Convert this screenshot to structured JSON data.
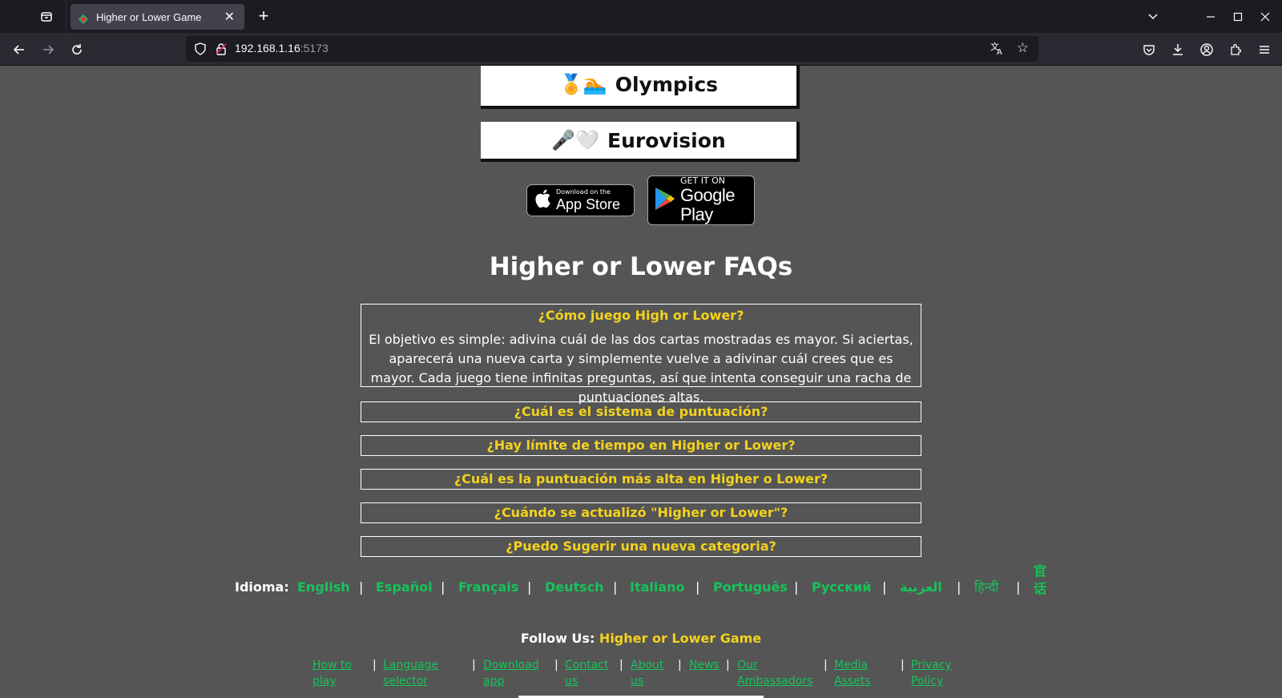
{
  "browser": {
    "tab_title": "Higher or Lower Game",
    "url_host": "192.168.1.16",
    "url_port": ":5173"
  },
  "categories": [
    {
      "emoji": "🏅🏊",
      "label": "Olympics"
    },
    {
      "emoji": "🎤🤍",
      "label": "Eurovision"
    }
  ],
  "store": {
    "appstore_small": "Download on the",
    "appstore_big": "App Store",
    "gplay_small": "GET IT ON",
    "gplay_big": "Google Play"
  },
  "faq": {
    "title": "Higher or Lower FAQs",
    "items": [
      {
        "q": "¿Cómo juego High or Lower?",
        "a": "El objetivo es simple: adivina cuál de las dos cartas mostradas es mayor. Si aciertas, aparecerá una nueva carta y simplemente vuelve a adivinar cuál crees que es mayor. Cada juego tiene infinitas preguntas, así que intenta conseguir una racha de puntuaciones altas."
      },
      {
        "q": "¿Cuál es el sistema de puntuación?"
      },
      {
        "q": "¿Hay límite de tiempo en Higher or Lower?"
      },
      {
        "q": "¿Cuál es la puntuación más alta en Higher o Lower?"
      },
      {
        "q": "¿Cuándo se actualizó \"Higher or Lower\"?"
      },
      {
        "q": "¿Puedo Sugerir una nueva categoria?"
      }
    ]
  },
  "languages": {
    "label": "Idioma:",
    "items": [
      "English",
      "Español",
      "Français",
      "Deutsch",
      "Italiano",
      "Português",
      "Русский",
      "العربية",
      "हिन्दी",
      "官话"
    ],
    "separator": "|"
  },
  "follow": {
    "label": "Follow Us:",
    "link": "Higher or Lower Game"
  },
  "footer": {
    "links": [
      "How to play",
      "Language selector",
      "Download app",
      "Contact us",
      "About us",
      "News",
      "Our Ambassadors",
      "Media Assets",
      "Privacy Policy"
    ]
  },
  "colors": {
    "page_bg": "#555555",
    "accent_yellow": "#f3d21d",
    "accent_green": "#16c45a"
  }
}
